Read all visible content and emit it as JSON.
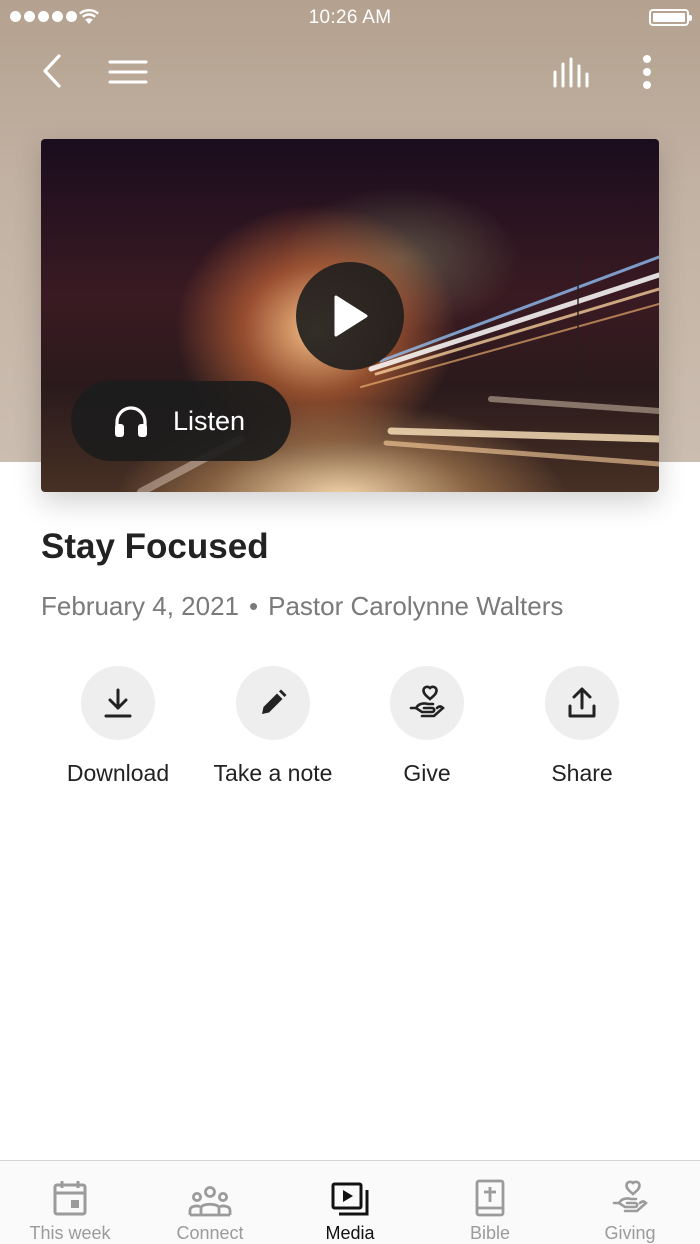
{
  "status_bar": {
    "time": "10:26 AM"
  },
  "header": {
    "back_icon": "chevron-left-icon",
    "menu_icon": "hamburger-icon",
    "audio_icon": "audio-bars-icon",
    "more_icon": "vertical-dots-icon"
  },
  "media": {
    "listen_label": "Listen",
    "title": "Stay Focused",
    "date": "February 4, 2021",
    "separator": "•",
    "speaker": "Pastor Carolynne Walters"
  },
  "actions": [
    {
      "label": "Download",
      "icon": "download-icon"
    },
    {
      "label": "Take a note",
      "icon": "pencil-icon"
    },
    {
      "label": "Give",
      "icon": "hand-heart-icon"
    },
    {
      "label": "Share",
      "icon": "share-icon"
    }
  ],
  "tabs": [
    {
      "label": "This week",
      "icon": "calendar-icon",
      "active": false
    },
    {
      "label": "Connect",
      "icon": "people-icon",
      "active": false
    },
    {
      "label": "Media",
      "icon": "video-library-icon",
      "active": true
    },
    {
      "label": "Bible",
      "icon": "bible-icon",
      "active": false
    },
    {
      "label": "Giving",
      "icon": "hand-heart-icon",
      "active": false
    }
  ],
  "colors": {
    "header_bg": "#b4a18f",
    "text_primary": "#222222",
    "text_secondary": "#7a7a7a",
    "tab_inactive": "#9b9b9b",
    "tab_active": "#111111"
  }
}
